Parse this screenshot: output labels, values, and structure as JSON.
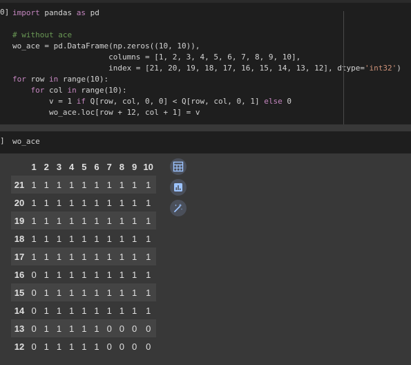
{
  "cell1": {
    "prompt": "0]",
    "code": {
      "l1_kw1": "import",
      "l1_t1": " pandas ",
      "l1_kw2": "as",
      "l1_t2": " pd",
      "l3_comment": "# without ace",
      "l4": "wo_ace = pd.DataFrame(np.zeros((10, 10)),",
      "l5": "                     columns = [1, 2, 3, 4, 5, 6, 7, 8, 9, 10],",
      "l6_a": "                     index = [21, 20, 19, 18, 17, 16, 15, 14, 13, 12], dtype=",
      "l6_str": "'int32'",
      "l6_b": ")",
      "l7_kw1": "for",
      "l7_t1": " row ",
      "l7_kw2": "in",
      "l7_t2": " range(10):",
      "l8_pre": "    ",
      "l8_kw1": "for",
      "l8_t1": " col ",
      "l8_kw2": "in",
      "l8_t2": " range(10):",
      "l9_a": "        v = 1 ",
      "l9_kw1": "if",
      "l9_b": " Q[row, col, 0, 0] < Q[row, col, 0, 1] ",
      "l9_kw2": "else",
      "l9_c": " 0",
      "l10": "        wo_ace.loc[row + 12, col + 1] = v"
    }
  },
  "cell2": {
    "prompt": "]",
    "code": "wo_ace"
  },
  "table": {
    "columns": [
      "1",
      "2",
      "3",
      "4",
      "5",
      "6",
      "7",
      "8",
      "9",
      "10"
    ],
    "rows": [
      {
        "index": "21",
        "values": [
          "1",
          "1",
          "1",
          "1",
          "1",
          "1",
          "1",
          "1",
          "1",
          "1"
        ]
      },
      {
        "index": "20",
        "values": [
          "1",
          "1",
          "1",
          "1",
          "1",
          "1",
          "1",
          "1",
          "1",
          "1"
        ]
      },
      {
        "index": "19",
        "values": [
          "1",
          "1",
          "1",
          "1",
          "1",
          "1",
          "1",
          "1",
          "1",
          "1"
        ]
      },
      {
        "index": "18",
        "values": [
          "1",
          "1",
          "1",
          "1",
          "1",
          "1",
          "1",
          "1",
          "1",
          "1"
        ]
      },
      {
        "index": "17",
        "values": [
          "1",
          "1",
          "1",
          "1",
          "1",
          "1",
          "1",
          "1",
          "1",
          "1"
        ]
      },
      {
        "index": "16",
        "values": [
          "0",
          "1",
          "1",
          "1",
          "1",
          "1",
          "1",
          "1",
          "1",
          "1"
        ]
      },
      {
        "index": "15",
        "values": [
          "0",
          "1",
          "1",
          "1",
          "1",
          "1",
          "1",
          "1",
          "1",
          "1"
        ]
      },
      {
        "index": "14",
        "values": [
          "0",
          "1",
          "1",
          "1",
          "1",
          "1",
          "1",
          "1",
          "1",
          "1"
        ]
      },
      {
        "index": "13",
        "values": [
          "0",
          "1",
          "1",
          "1",
          "1",
          "1",
          "0",
          "0",
          "0",
          "0"
        ]
      },
      {
        "index": "12",
        "values": [
          "0",
          "1",
          "1",
          "1",
          "1",
          "1",
          "0",
          "0",
          "0",
          "0"
        ]
      }
    ]
  },
  "icons": [
    "table-calculator-icon",
    "bar-chart-icon",
    "magic-wand-icon"
  ],
  "colors": {
    "cell_bg": "#1e1e1e",
    "output_bg": "#383838",
    "keyword": "#c586c0",
    "comment": "#6a9955",
    "string": "#ce9178"
  }
}
